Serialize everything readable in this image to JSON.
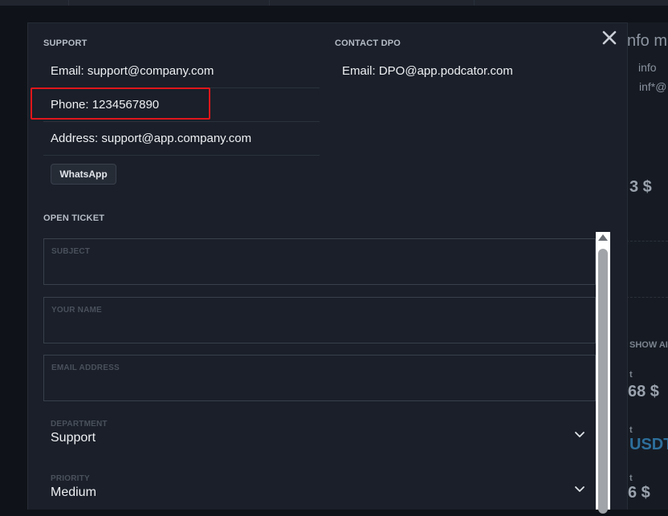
{
  "background": {
    "title": "nfo m",
    "line1": "info",
    "line2": "inf*@",
    "amount1": "3 $",
    "show_label": "SHOW AI",
    "label_a": "t",
    "amount2": "68 $",
    "label_b": "t",
    "amount3": "USDT",
    "label_c": "t",
    "amount4": "6 $"
  },
  "modal": {
    "close": "✕",
    "support": {
      "title": "SUPPORT",
      "email": "Email:  support@company.com",
      "phone": "Phone:  1234567890",
      "address": "Address:  support@app.company.com",
      "whatsapp": "WhatsApp"
    },
    "dpo": {
      "title": "CONTACT DPO",
      "email": "Email:  DPO@app.podcator.com"
    },
    "ticket": {
      "title": "OPEN TICKET",
      "subject_label": "SUBJECT",
      "subject_value": "",
      "name_label": "YOUR NAME",
      "name_value": "",
      "email_label": "EMAIL ADDRESS",
      "email_value": "",
      "department_label": "DEPARTMENT",
      "department_value": "Support",
      "priority_label": "PRIORITY",
      "priority_value": "Medium"
    }
  },
  "icons": {
    "close": "close-icon",
    "chevron": "chevron-down-icon",
    "scroll_up": "scroll-up-arrow-icon"
  },
  "colors": {
    "highlight": "#e0161b",
    "modal_bg": "#1a1f29",
    "page_bg": "#0f1319"
  }
}
